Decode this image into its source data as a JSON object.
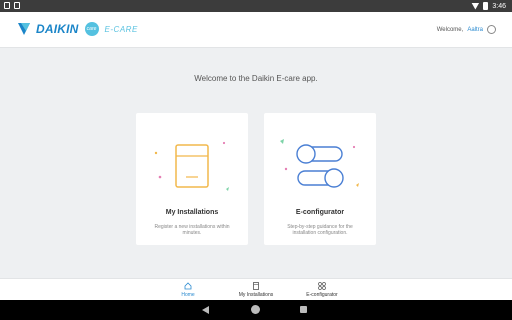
{
  "status_bar": {
    "time": "3:46"
  },
  "app_bar": {
    "brand": "DAIKIN",
    "logo_badge": "care",
    "app_name": "E-CARE",
    "welcome_prefix": "Welcome,",
    "user_name": "Aaltra"
  },
  "main": {
    "heading": "Welcome to the Daikin E-care app.",
    "cards": [
      {
        "title": "My Installations",
        "description": "Register a new installations within minutes.",
        "icon": "tablet-document-icon"
      },
      {
        "title": "E-configurator",
        "description": "Step-by-step guidance for the installation configuration.",
        "icon": "toggle-switches-icon"
      }
    ]
  },
  "bottom_nav": [
    {
      "label": "Home",
      "icon": "home-icon",
      "active": true
    },
    {
      "label": "My Installations",
      "icon": "installations-icon",
      "active": false
    },
    {
      "label": "E-configurator",
      "icon": "configurator-icon",
      "active": false
    }
  ],
  "colors": {
    "accent": "#2b8bd0",
    "brand_blue": "#1b85c8",
    "care_cyan": "#54c1e0",
    "icon_orange": "#f2b84b",
    "icon_blue": "#4a7fd4"
  }
}
